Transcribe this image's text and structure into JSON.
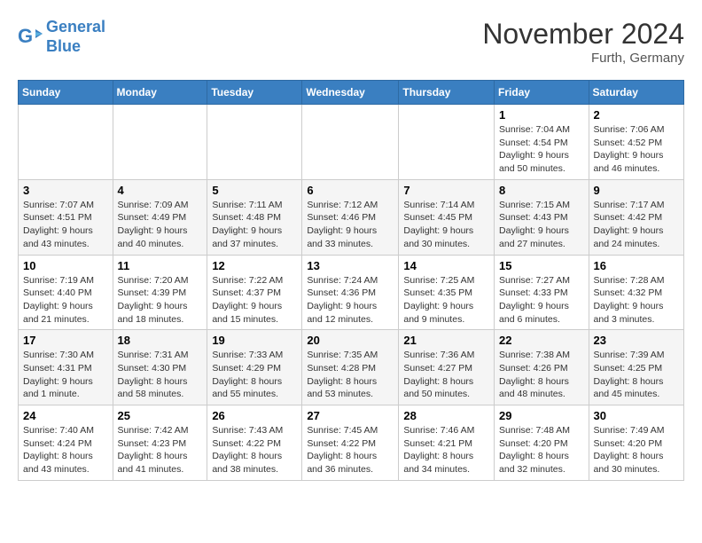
{
  "logo": {
    "line1": "General",
    "line2": "Blue"
  },
  "title": "November 2024",
  "location": "Furth, Germany",
  "days_header": [
    "Sunday",
    "Monday",
    "Tuesday",
    "Wednesday",
    "Thursday",
    "Friday",
    "Saturday"
  ],
  "weeks": [
    [
      {
        "num": "",
        "info": ""
      },
      {
        "num": "",
        "info": ""
      },
      {
        "num": "",
        "info": ""
      },
      {
        "num": "",
        "info": ""
      },
      {
        "num": "",
        "info": ""
      },
      {
        "num": "1",
        "info": "Sunrise: 7:04 AM\nSunset: 4:54 PM\nDaylight: 9 hours\nand 50 minutes."
      },
      {
        "num": "2",
        "info": "Sunrise: 7:06 AM\nSunset: 4:52 PM\nDaylight: 9 hours\nand 46 minutes."
      }
    ],
    [
      {
        "num": "3",
        "info": "Sunrise: 7:07 AM\nSunset: 4:51 PM\nDaylight: 9 hours\nand 43 minutes."
      },
      {
        "num": "4",
        "info": "Sunrise: 7:09 AM\nSunset: 4:49 PM\nDaylight: 9 hours\nand 40 minutes."
      },
      {
        "num": "5",
        "info": "Sunrise: 7:11 AM\nSunset: 4:48 PM\nDaylight: 9 hours\nand 37 minutes."
      },
      {
        "num": "6",
        "info": "Sunrise: 7:12 AM\nSunset: 4:46 PM\nDaylight: 9 hours\nand 33 minutes."
      },
      {
        "num": "7",
        "info": "Sunrise: 7:14 AM\nSunset: 4:45 PM\nDaylight: 9 hours\nand 30 minutes."
      },
      {
        "num": "8",
        "info": "Sunrise: 7:15 AM\nSunset: 4:43 PM\nDaylight: 9 hours\nand 27 minutes."
      },
      {
        "num": "9",
        "info": "Sunrise: 7:17 AM\nSunset: 4:42 PM\nDaylight: 9 hours\nand 24 minutes."
      }
    ],
    [
      {
        "num": "10",
        "info": "Sunrise: 7:19 AM\nSunset: 4:40 PM\nDaylight: 9 hours\nand 21 minutes."
      },
      {
        "num": "11",
        "info": "Sunrise: 7:20 AM\nSunset: 4:39 PM\nDaylight: 9 hours\nand 18 minutes."
      },
      {
        "num": "12",
        "info": "Sunrise: 7:22 AM\nSunset: 4:37 PM\nDaylight: 9 hours\nand 15 minutes."
      },
      {
        "num": "13",
        "info": "Sunrise: 7:24 AM\nSunset: 4:36 PM\nDaylight: 9 hours\nand 12 minutes."
      },
      {
        "num": "14",
        "info": "Sunrise: 7:25 AM\nSunset: 4:35 PM\nDaylight: 9 hours\nand 9 minutes."
      },
      {
        "num": "15",
        "info": "Sunrise: 7:27 AM\nSunset: 4:33 PM\nDaylight: 9 hours\nand 6 minutes."
      },
      {
        "num": "16",
        "info": "Sunrise: 7:28 AM\nSunset: 4:32 PM\nDaylight: 9 hours\nand 3 minutes."
      }
    ],
    [
      {
        "num": "17",
        "info": "Sunrise: 7:30 AM\nSunset: 4:31 PM\nDaylight: 9 hours\nand 1 minute."
      },
      {
        "num": "18",
        "info": "Sunrise: 7:31 AM\nSunset: 4:30 PM\nDaylight: 8 hours\nand 58 minutes."
      },
      {
        "num": "19",
        "info": "Sunrise: 7:33 AM\nSunset: 4:29 PM\nDaylight: 8 hours\nand 55 minutes."
      },
      {
        "num": "20",
        "info": "Sunrise: 7:35 AM\nSunset: 4:28 PM\nDaylight: 8 hours\nand 53 minutes."
      },
      {
        "num": "21",
        "info": "Sunrise: 7:36 AM\nSunset: 4:27 PM\nDaylight: 8 hours\nand 50 minutes."
      },
      {
        "num": "22",
        "info": "Sunrise: 7:38 AM\nSunset: 4:26 PM\nDaylight: 8 hours\nand 48 minutes."
      },
      {
        "num": "23",
        "info": "Sunrise: 7:39 AM\nSunset: 4:25 PM\nDaylight: 8 hours\nand 45 minutes."
      }
    ],
    [
      {
        "num": "24",
        "info": "Sunrise: 7:40 AM\nSunset: 4:24 PM\nDaylight: 8 hours\nand 43 minutes."
      },
      {
        "num": "25",
        "info": "Sunrise: 7:42 AM\nSunset: 4:23 PM\nDaylight: 8 hours\nand 41 minutes."
      },
      {
        "num": "26",
        "info": "Sunrise: 7:43 AM\nSunset: 4:22 PM\nDaylight: 8 hours\nand 38 minutes."
      },
      {
        "num": "27",
        "info": "Sunrise: 7:45 AM\nSunset: 4:22 PM\nDaylight: 8 hours\nand 36 minutes."
      },
      {
        "num": "28",
        "info": "Sunrise: 7:46 AM\nSunset: 4:21 PM\nDaylight: 8 hours\nand 34 minutes."
      },
      {
        "num": "29",
        "info": "Sunrise: 7:48 AM\nSunset: 4:20 PM\nDaylight: 8 hours\nand 32 minutes."
      },
      {
        "num": "30",
        "info": "Sunrise: 7:49 AM\nSunset: 4:20 PM\nDaylight: 8 hours\nand 30 minutes."
      }
    ]
  ]
}
